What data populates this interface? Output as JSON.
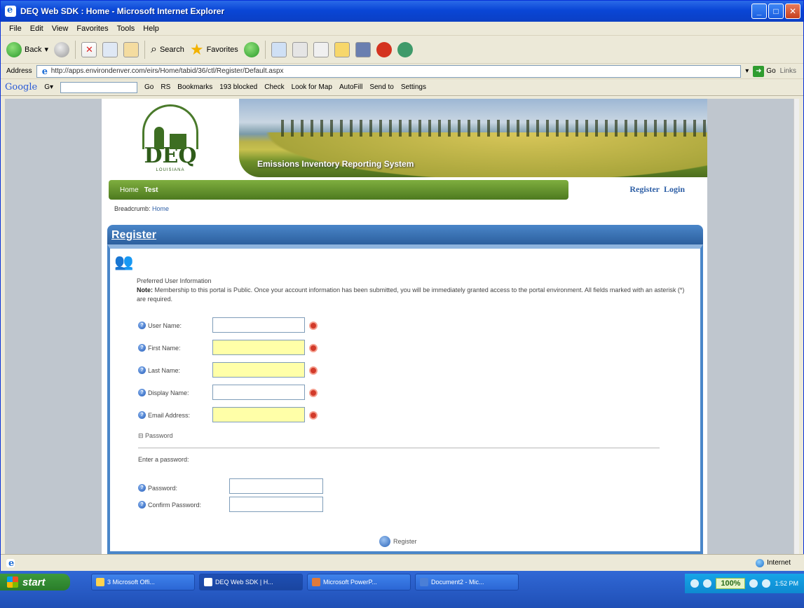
{
  "window": {
    "title": "DEQ Web SDK : Home - Microsoft Internet Explorer"
  },
  "menu": [
    "File",
    "Edit",
    "View",
    "Favorites",
    "Tools",
    "Help"
  ],
  "toolbar": {
    "back_label": "Back",
    "search_label": "Search",
    "favorites_label": "Favorites"
  },
  "address": {
    "label": "Address",
    "url": "http://apps.environdenver.com/eirs/Home/tabid/36/ctl/Register/Default.aspx",
    "go_label": "Go",
    "links_label": "Links"
  },
  "google_bar": {
    "logo": "Google",
    "items": [
      "Go",
      "RS",
      "Bookmarks",
      "193 blocked",
      "Check",
      "Look for Map",
      "AutoFill",
      "Send to",
      "Settings"
    ]
  },
  "site": {
    "logo_text": "DEQ",
    "logo_sub": "LOUISIANA",
    "banner_caption": "Emissions Inventory Reporting System",
    "nav": [
      "Home",
      "Test"
    ],
    "register_link": "Register",
    "login_link": "Login",
    "breadcrumb_label": "Breadcrumb:",
    "breadcrumb_home": "Home"
  },
  "register": {
    "heading": "Register",
    "info_title": "Preferred User Information",
    "note_label": "Note:",
    "note_text": "Membership to this portal is Public. Once your account information has been submitted, you will be immediately granted access to the portal environment. All fields marked with an asterisk (*) are required.",
    "fields": [
      {
        "label": "User Name:",
        "highlighted": false
      },
      {
        "label": "First Name:",
        "highlighted": true
      },
      {
        "label": "Last Name:",
        "highlighted": true
      },
      {
        "label": "Display Name:",
        "highlighted": false
      },
      {
        "label": "Email Address:",
        "highlighted": true
      }
    ],
    "password_section": "Password",
    "password_prompt": "Enter a password:",
    "password_label": "Password:",
    "confirm_label": "Confirm Password:",
    "register_button": "Register"
  },
  "status": {
    "zone": "Internet"
  },
  "taskbar": {
    "start": "start",
    "tasks": [
      "3 Microsoft Offi...",
      "DEQ Web SDK | H...",
      "Microsoft PowerP...",
      "Document2 - Mic..."
    ],
    "zoom": "100%",
    "clock": "1:52 PM"
  }
}
